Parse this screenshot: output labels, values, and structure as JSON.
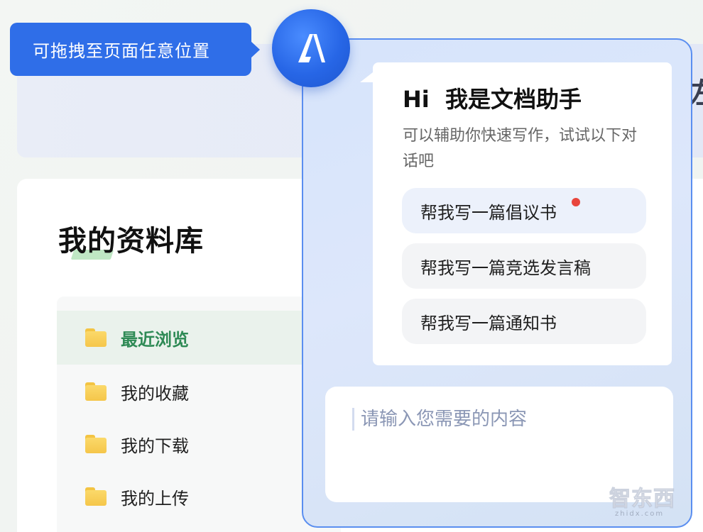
{
  "tooltip": {
    "text": "可拖拽至页面任意位置"
  },
  "banner": {
    "partial_char": "左"
  },
  "library": {
    "title": "我的资料库",
    "items": [
      {
        "label": "最近浏览",
        "active": true
      },
      {
        "label": "我的收藏",
        "active": false
      },
      {
        "label": "我的下载",
        "active": false
      },
      {
        "label": "我的上传",
        "active": false
      }
    ]
  },
  "assistant": {
    "greeting": "Hi  我是文档助手",
    "subtitle": "可以辅助你快速写作，试试以下对话吧",
    "suggestions": [
      {
        "label": "帮我写一篇倡议书",
        "new": true
      },
      {
        "label": "帮我写一篇竞选发言稿",
        "new": false
      },
      {
        "label": "帮我写一篇通知书",
        "new": false
      }
    ],
    "input_placeholder": "请输入您需要的内容"
  },
  "watermark": {
    "text": "智东西",
    "sub": "zhidx.com"
  },
  "colors": {
    "accent": "#2f6ee8",
    "active_text": "#2e8a55",
    "notify_dot": "#e8453c",
    "folder": "#f5c64a"
  },
  "icons": {
    "avatar": "assistant-logo-icon",
    "folder": "folder-icon"
  }
}
